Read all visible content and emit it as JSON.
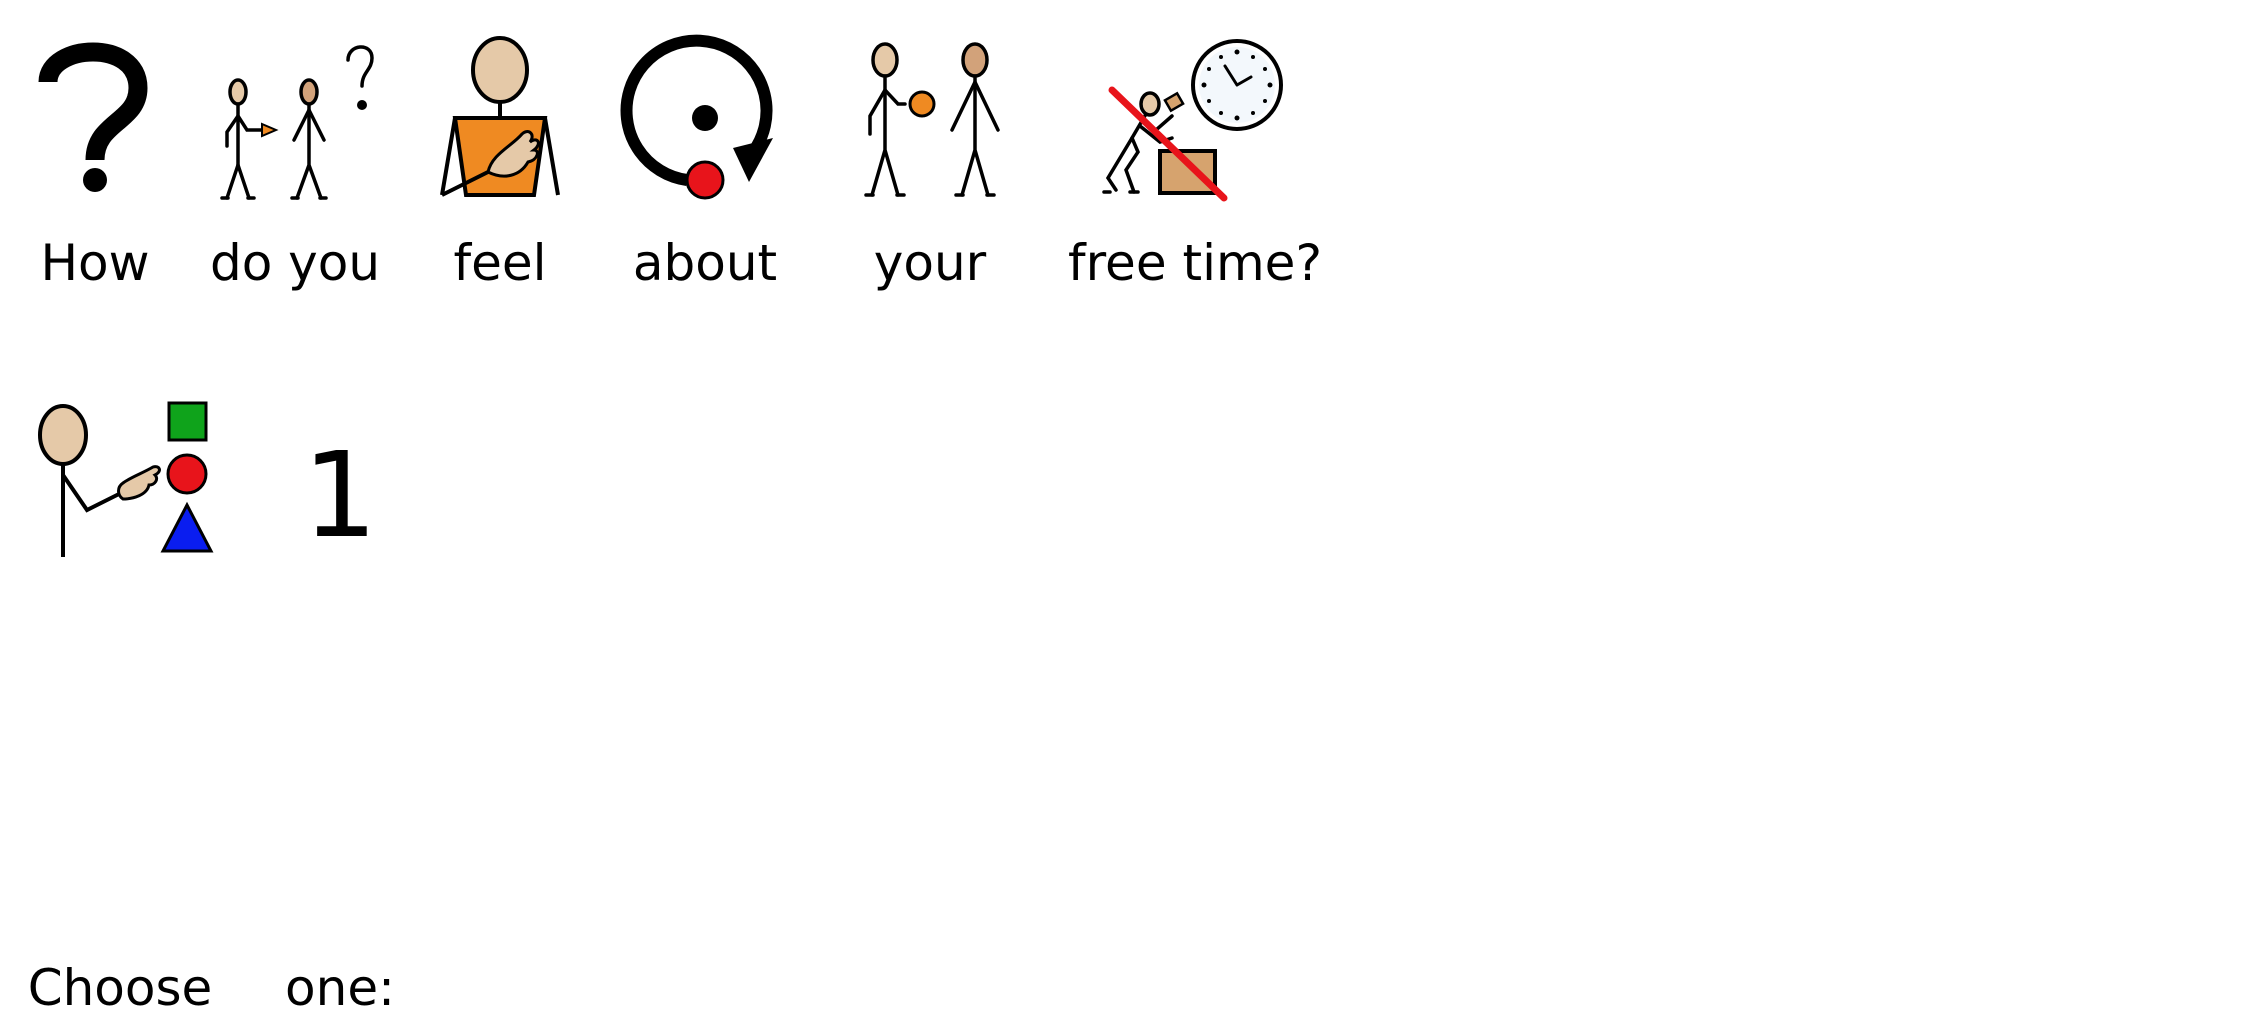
{
  "sentence": [
    {
      "word": "How",
      "icon": "question-mark-icon"
    },
    {
      "word": "do you",
      "icon": "person-asking-person-icon"
    },
    {
      "word": "feel",
      "icon": "hand-on-chest-icon"
    },
    {
      "word": "about",
      "icon": "circle-around-point-icon"
    },
    {
      "word": "your",
      "icon": "person-giving-to-person-icon"
    },
    {
      "word": "free time?",
      "icon": "no-work-clock-icon"
    }
  ],
  "instruction": [
    {
      "word": "Choose",
      "icon": "person-pointing-shapes-icon"
    },
    {
      "word": "one:",
      "icon": "number-one-icon",
      "glyph": "1"
    }
  ],
  "colors": {
    "skin": "#e5c9a8",
    "skin_dark": "#d2a27a",
    "orange": "#ef8a22",
    "red": "#e8141b",
    "green": "#0fa31b",
    "blue": "#0a1df0",
    "box": "#d6a36e"
  }
}
